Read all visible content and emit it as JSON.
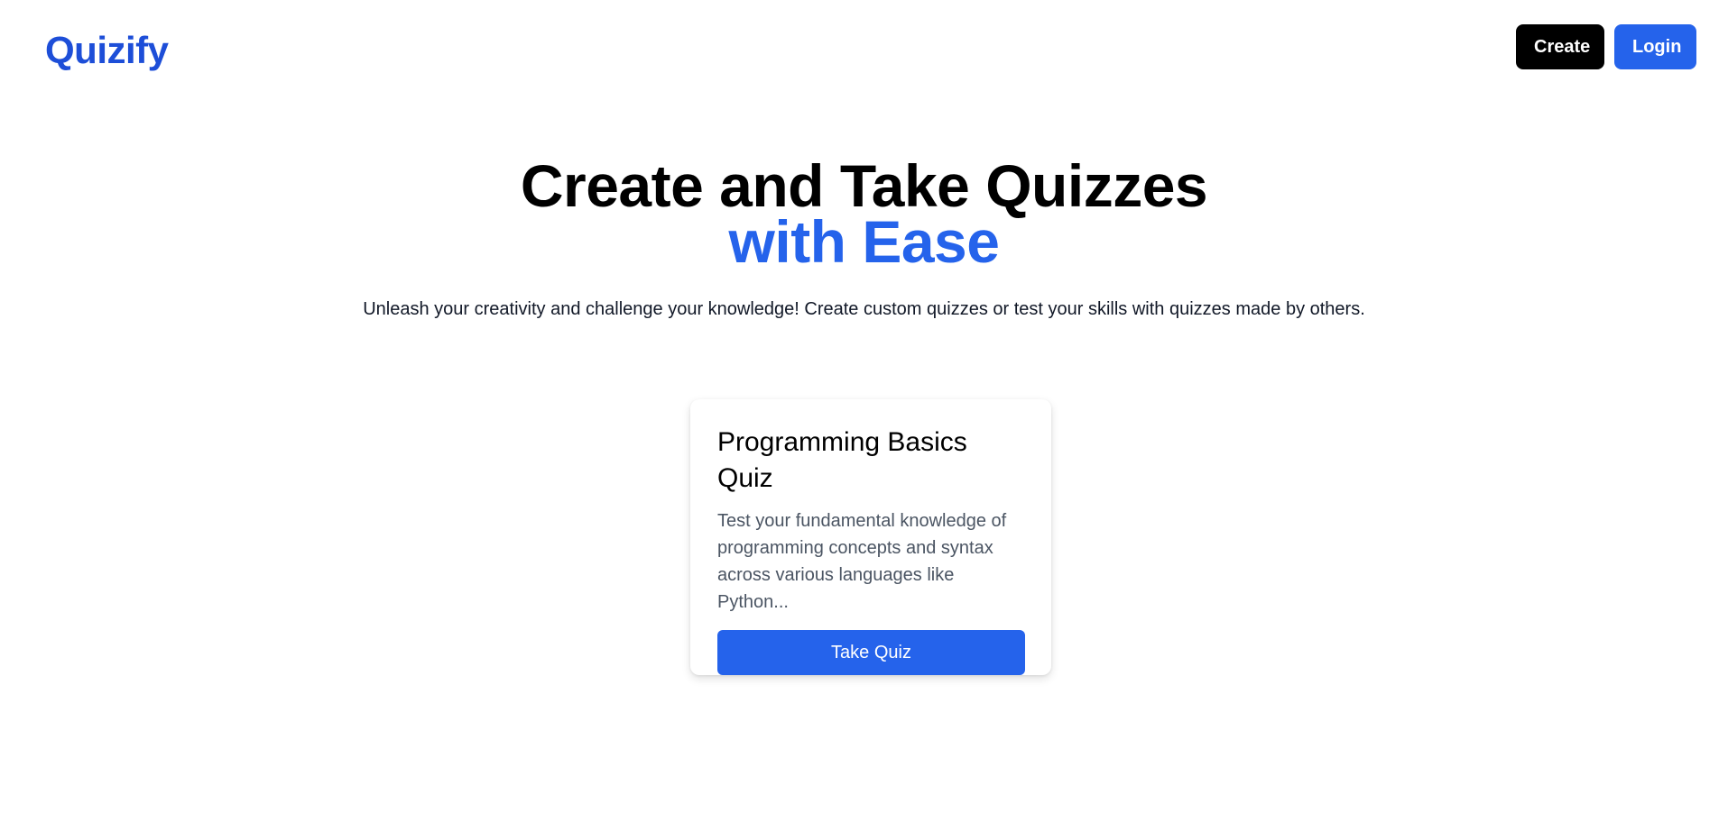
{
  "header": {
    "logo": "Quizify",
    "create_label": "Create",
    "login_label": "Login"
  },
  "hero": {
    "title_line1": "Create and Take Quizzes",
    "title_line2": "with Ease",
    "subtitle": "Unleash your creativity and challenge your knowledge! Create custom quizzes or test your skills with quizzes made by others."
  },
  "quizzes": [
    {
      "title": "Programming Basics Quiz",
      "description": "Test your fundamental knowledge of programming concepts and syntax across various languages like Python...",
      "button_label": "Take Quiz"
    }
  ],
  "colors": {
    "brand_blue": "#2563eb",
    "logo_blue": "#1d4ed8",
    "create_button": "#000000"
  }
}
